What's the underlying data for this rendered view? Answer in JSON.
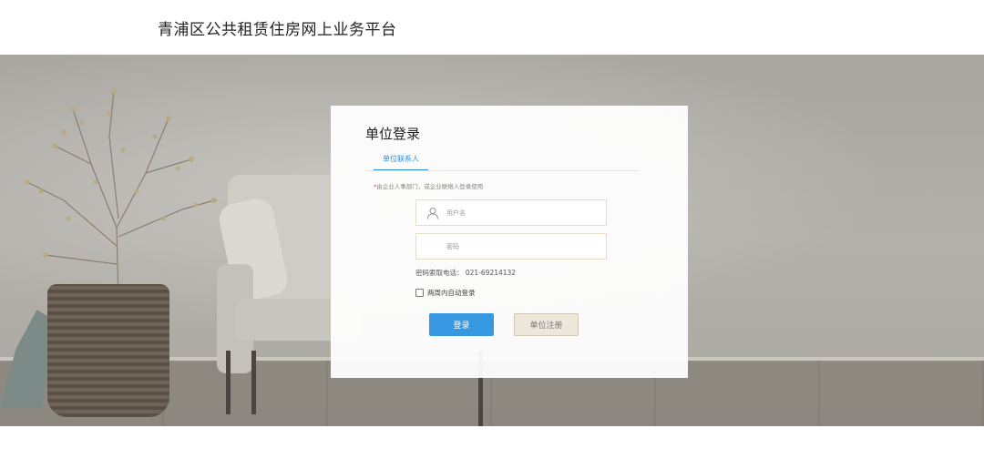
{
  "header": {
    "site_title": "青浦区公共租赁住房网上业务平台"
  },
  "login_card": {
    "title": "单位登录",
    "tabs": [
      {
        "label": "单位联系人",
        "active": true
      }
    ],
    "notice_marker": "*",
    "notice": "由企业人事部门，或企业联络人登录使用",
    "username": {
      "value": "",
      "placeholder": "用户名",
      "icon": "user-icon"
    },
    "password": {
      "value": "",
      "placeholder": "密码"
    },
    "password_recovery": "密码索取电话： 021-69214132",
    "remember": {
      "label": "两周内自动登录",
      "checked": false
    },
    "login_button": "登录",
    "register_button": "单位注册"
  },
  "colors": {
    "accent": "#3598e0",
    "tab_active": "#2e8fd8",
    "required": "#e04040"
  }
}
